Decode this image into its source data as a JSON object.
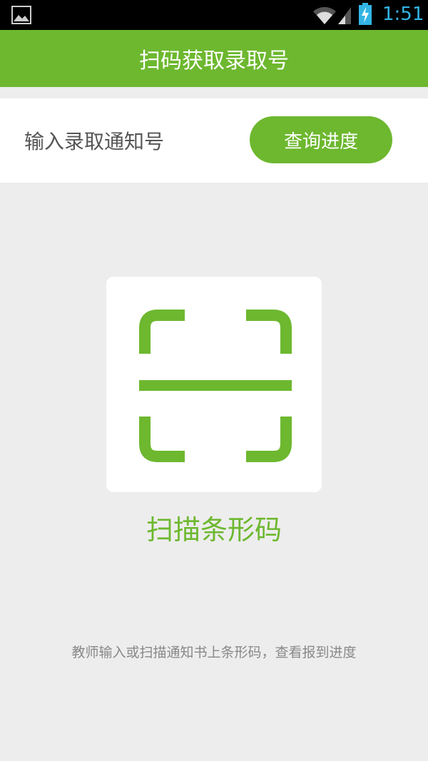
{
  "status_bar": {
    "time": "1:51",
    "icons": [
      "image-icon",
      "wifi-icon",
      "signal-icon",
      "battery-charging-icon"
    ]
  },
  "app_bar": {
    "title": "扫码获取录取号"
  },
  "query": {
    "placeholder": "输入录取通知号",
    "button_label": "查询进度"
  },
  "scan": {
    "icon": "barcode-scan-icon",
    "label": "扫描条形码"
  },
  "hint": "教师输入或扫描通知书上条形码，查看报到进度",
  "colors": {
    "accent": "#6db82f",
    "background": "#ededed",
    "status_bar": "#000000",
    "status_text": "#33b5e5"
  }
}
